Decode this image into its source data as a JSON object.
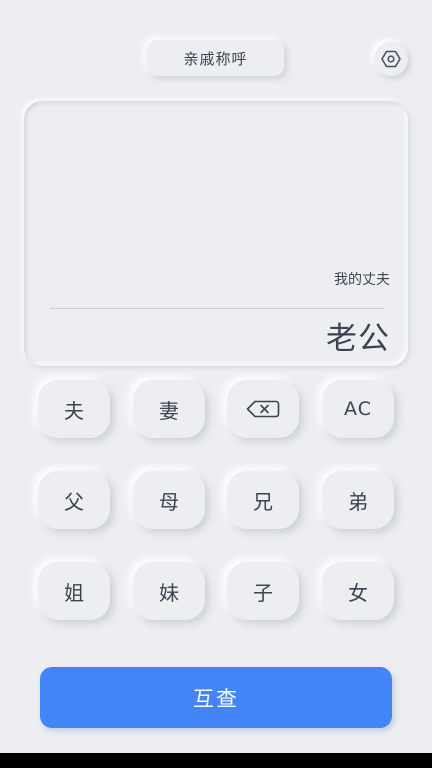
{
  "header": {
    "title": "亲戚称呼",
    "settings_icon": "hexagon-settings-icon"
  },
  "display": {
    "expression": "我的丈夫",
    "result": "老公"
  },
  "keypad": {
    "rows": [
      [
        "夫",
        "妻",
        "backspace",
        "AC"
      ],
      [
        "父",
        "母",
        "兄",
        "弟"
      ],
      [
        "姐",
        "妹",
        "子",
        "女"
      ]
    ],
    "husband": "夫",
    "wife": "妻",
    "backspace_icon": "backspace-icon",
    "clear": "AC",
    "father": "父",
    "mother": "母",
    "elder_brother": "兄",
    "younger_brother": "弟",
    "elder_sister": "姐",
    "younger_sister": "妹",
    "son": "子",
    "daughter": "女"
  },
  "actions": {
    "mutual_check": "互查"
  },
  "colors": {
    "background": "#eceef2",
    "accent": "#4285f7",
    "text": "#3d4350"
  }
}
